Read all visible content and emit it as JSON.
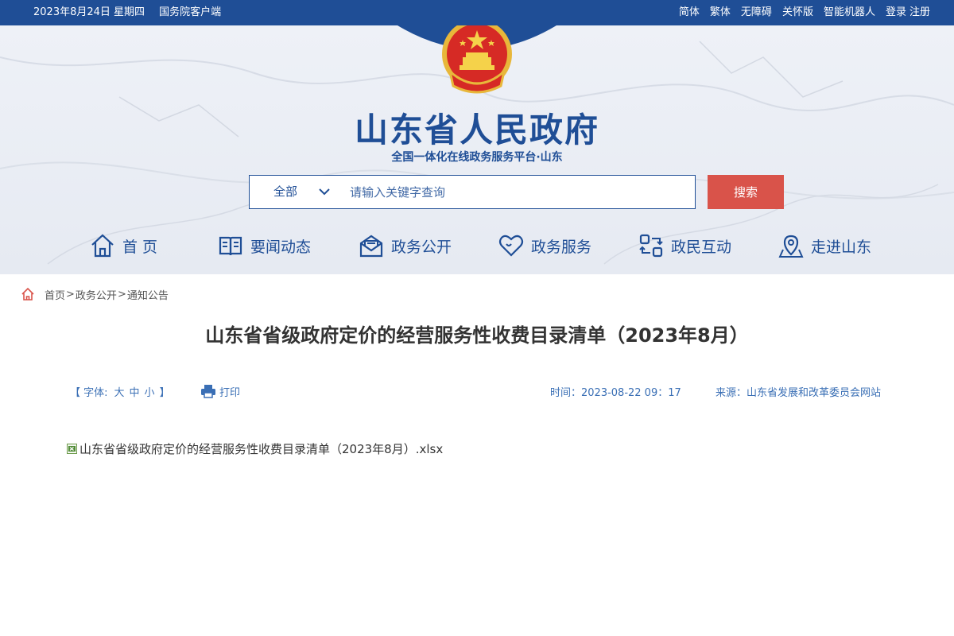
{
  "topbar": {
    "date": "2023年8月24日 星期四",
    "client_link": "国务院客户端",
    "links": [
      "简体",
      "繁体",
      "无障碍",
      "关怀版",
      "智能机器人",
      "登录",
      "注册"
    ]
  },
  "header": {
    "title": "山东省人民政府",
    "subtitle": "全国一体化在线政务服务平台·山东"
  },
  "search": {
    "scope": "全部",
    "placeholder": "请输入关键字查询",
    "button": "搜索"
  },
  "nav": {
    "items": [
      {
        "label": "首 页",
        "icon": "home-icon"
      },
      {
        "label": "要闻动态",
        "icon": "book-icon"
      },
      {
        "label": "政务公开",
        "icon": "mail-icon"
      },
      {
        "label": "政务服务",
        "icon": "heart-icon"
      },
      {
        "label": "政民互动",
        "icon": "interaction-icon"
      },
      {
        "label": "走进山东",
        "icon": "location-icon"
      }
    ]
  },
  "breadcrumb": {
    "items": [
      "首页",
      "政务公开",
      "通知公告"
    ],
    "separator": ">"
  },
  "article": {
    "title": "山东省省级政府定价的经营服务性收费目录清单（2023年8月）",
    "font_label": "【 字体:",
    "font_sizes": [
      "大",
      "中",
      "小"
    ],
    "font_end": "】",
    "print_label": "打印",
    "time": "时间：2023-08-22 09：17",
    "source": "来源：山东省发展和改革委员会网站",
    "attachment": "山东省省级政府定价的经营服务性收费目录清单（2023年8月）.xlsx"
  },
  "colors": {
    "primary": "#1f4e96",
    "search_button": "#d9534a",
    "meta_text": "#3a6fb5"
  }
}
